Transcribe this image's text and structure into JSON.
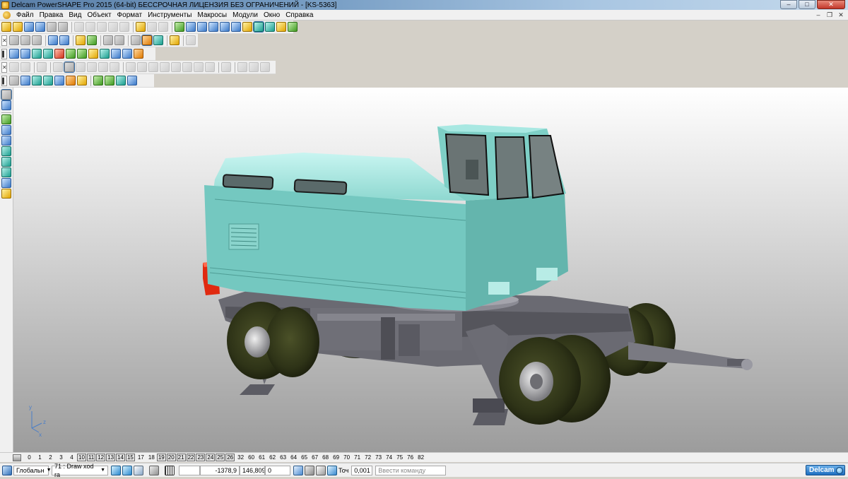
{
  "window": {
    "title": "Delcam PowerSHAPE Pro 2015 (64-bit) БЕССРОЧНАЯ ЛИЦЕНЗИЯ БЕЗ ОГРАНИЧЕНИЙ - [KS-5363]",
    "minimize": "–",
    "maximize": "□",
    "close": "✕",
    "mdi_minimize": "–",
    "mdi_restore": "❐",
    "mdi_close": "✕"
  },
  "menu": {
    "items": [
      "Файл",
      "Правка",
      "Вид",
      "Объект",
      "Формат",
      "Инструменты",
      "Макросы",
      "Модули",
      "Окно",
      "Справка"
    ]
  },
  "viewport": {
    "model_name": "KS-5363",
    "axis_x": "x",
    "axis_y": "y",
    "axis_z": "z",
    "colors": {
      "body": "#74c8c0",
      "body_light": "#a6e8e2",
      "counterweight": "#e02a10",
      "chassis": "#6a6a72",
      "tire": "#2f3418"
    }
  },
  "numbar": {
    "items": [
      {
        "label": "0",
        "boxed": false
      },
      {
        "label": "1",
        "boxed": false
      },
      {
        "label": "2",
        "boxed": false
      },
      {
        "label": "3",
        "boxed": false
      },
      {
        "label": "4",
        "boxed": false
      },
      {
        "label": "10",
        "boxed": true
      },
      {
        "label": "11",
        "boxed": true
      },
      {
        "label": "12",
        "boxed": true
      },
      {
        "label": "13",
        "boxed": true
      },
      {
        "label": "14",
        "boxed": true
      },
      {
        "label": "15",
        "boxed": true
      },
      {
        "label": "17",
        "boxed": false
      },
      {
        "label": "18",
        "boxed": false
      },
      {
        "label": "19",
        "boxed": true
      },
      {
        "label": "20",
        "boxed": true
      },
      {
        "label": "21",
        "boxed": true
      },
      {
        "label": "22",
        "boxed": true
      },
      {
        "label": "23",
        "boxed": true
      },
      {
        "label": "24",
        "boxed": true
      },
      {
        "label": "25",
        "boxed": true
      },
      {
        "label": "26",
        "boxed": true
      },
      {
        "label": "32",
        "boxed": false
      },
      {
        "label": "60",
        "boxed": false
      },
      {
        "label": "61",
        "boxed": false
      },
      {
        "label": "62",
        "boxed": false
      },
      {
        "label": "63",
        "boxed": false
      },
      {
        "label": "64",
        "boxed": false
      },
      {
        "label": "65",
        "boxed": false
      },
      {
        "label": "67",
        "boxed": false
      },
      {
        "label": "68",
        "boxed": false
      },
      {
        "label": "69",
        "boxed": false
      },
      {
        "label": "70",
        "boxed": false
      },
      {
        "label": "71",
        "boxed": false
      },
      {
        "label": "72",
        "boxed": false
      },
      {
        "label": "73",
        "boxed": false
      },
      {
        "label": "74",
        "boxed": false
      },
      {
        "label": "75",
        "boxed": false
      },
      {
        "label": "76",
        "boxed": false
      },
      {
        "label": "82",
        "boxed": false
      }
    ]
  },
  "statusbar": {
    "workplane": "Глобальн",
    "layer": "71 : Draw xod ra",
    "coord_x": "-1378,9",
    "coord_y": "146,809",
    "coord_z": "0",
    "tolerance_label": "Точ",
    "tolerance_value": "0,001",
    "command_placeholder": "Ввести команду",
    "brand": "Delcam"
  }
}
